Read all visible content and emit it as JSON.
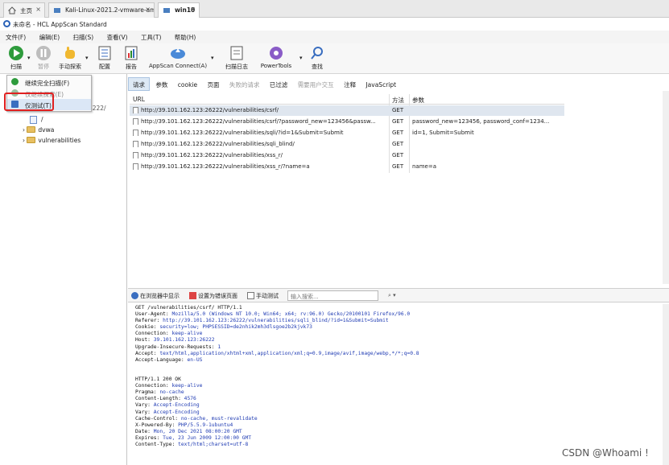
{
  "browser_tabs": [
    {
      "label": "主页",
      "active": false
    },
    {
      "label": "Kali-Linux-2021.2-vmware-am...",
      "active": false
    },
    {
      "label": "win10",
      "active": true
    }
  ],
  "window_title": "未命名 - HCL AppScan Standard",
  "menu": [
    "文件(F)",
    "编辑(E)",
    "扫描(S)",
    "查看(V)",
    "工具(T)",
    "帮助(H)"
  ],
  "toolbar": {
    "scan": "扫描",
    "pause": "暂停",
    "manual_explore": "手动探索",
    "config": "配置",
    "report": "报告",
    "appscan_connect": "AppScan Connect(A)",
    "scan_log": "扫描日志",
    "powertools": "PowerTools",
    "find": "查找"
  },
  "scan_menu": {
    "items": [
      "继续完全扫描(F)",
      "仅继续探索(E)",
      "仅测试(T)"
    ]
  },
  "tree": {
    "host": "http://39.101.162.123:26222/",
    "children": [
      "/",
      "dvwa",
      "vulnerabilities"
    ]
  },
  "detail_tabs": [
    "请求",
    "参数",
    "cookie",
    "页面",
    "失败的请求",
    "已过滤",
    "需要用户交互",
    "注释",
    "JavaScript"
  ],
  "grid": {
    "headers": [
      "URL",
      "方法",
      "参数"
    ],
    "rows": [
      {
        "url": "http://39.101.162.123:26222/vulnerabilities/csrf/",
        "method": "GET",
        "params": ""
      },
      {
        "url": "http://39.101.162.123:26222/vulnerabilities/csrf/?password_new=123456&passw...",
        "method": "GET",
        "params": "password_new=123456, password_conf=1234..."
      },
      {
        "url": "http://39.101.162.123:26222/vulnerabilities/sqli/?id=1&Submit=Submit",
        "method": "GET",
        "params": "id=1, Submit=Submit"
      },
      {
        "url": "http://39.101.162.123:26222/vulnerabilities/sqli_blind/",
        "method": "GET",
        "params": ""
      },
      {
        "url": "http://39.101.162.123:26222/vulnerabilities/xss_r/",
        "method": "GET",
        "params": ""
      },
      {
        "url": "http://39.101.162.123:26222/vulnerabilities/xss_r/?name=a",
        "method": "GET",
        "params": "name=a"
      }
    ]
  },
  "request_toolbar": {
    "show_in_browser": "在浏览器中显示",
    "set_error_page": "设置为错误页面",
    "manual_test": "手动测试",
    "search_placeholder": "输入搜索..."
  },
  "request_text": [
    {
      "k": "GET /vulnerabilities/csrf/ HTTP/1.1",
      "v": ""
    },
    {
      "k": "User-Agent: ",
      "v": "Mozilla/5.0 (Windows NT 10.0; Win64; x64; rv:96.0) Gecko/20100101 Firefox/96.0"
    },
    {
      "k": "Referer: ",
      "v": "http://39.101.162.123:26222/vulnerabilities/sqli_blind/?id=1&Submit=Submit"
    },
    {
      "k": "Cookie: ",
      "v": "security=low; PHPSESSID=de2nhik2mh3dlsgoe2b2kjvk73"
    },
    {
      "k": "Connection: ",
      "v": "keep-alive"
    },
    {
      "k": "Host: ",
      "v": "39.101.162.123:26222"
    },
    {
      "k": "Upgrade-Insecure-Requests: ",
      "v": "1"
    },
    {
      "k": "Accept: ",
      "v": "text/html,application/xhtml+xml,application/xml;q=0.9,image/avif,image/webp,*/*;q=0.8"
    },
    {
      "k": "Accept-Language: ",
      "v": "en-US"
    },
    {
      "k": "",
      "v": ""
    },
    {
      "k": "",
      "v": ""
    },
    {
      "k": "HTTP/1.1 200 OK",
      "v": ""
    },
    {
      "k": "Connection: ",
      "v": "keep-alive"
    },
    {
      "k": "Pragma: ",
      "v": "no-cache"
    },
    {
      "k": "Content-Length: ",
      "v": "4576"
    },
    {
      "k": "Vary: ",
      "v": "Accept-Encoding"
    },
    {
      "k": "Vary: ",
      "v": "Accept-Encoding"
    },
    {
      "k": "Cache-Control: ",
      "v": "no-cache, must-revalidate"
    },
    {
      "k": "X-Powered-By: ",
      "v": "PHP/5.5.9-1ubuntu4"
    },
    {
      "k": "Date: ",
      "v": "Mon, 20 Dec 2021 08:00:20 GMT"
    },
    {
      "k": "Expires: ",
      "v": "Tue, 23 Jun 2009 12:00:00 GMT"
    },
    {
      "k": "Content-Type: ",
      "v": "text/html;charset=utf-8"
    }
  ],
  "watermark": "CSDN @Whoami !",
  "colors": {
    "highlight": "#e02020",
    "selection": "#dfe6ef",
    "link_value": "#1f3bb3"
  },
  "icons": [
    "home-icon",
    "vm-icon",
    "play-icon",
    "pause-icon",
    "hand-icon",
    "config-icon",
    "report-icon",
    "cloud-icon",
    "log-icon",
    "gear-icon",
    "search-icon",
    "folder-icon",
    "page-icon"
  ]
}
